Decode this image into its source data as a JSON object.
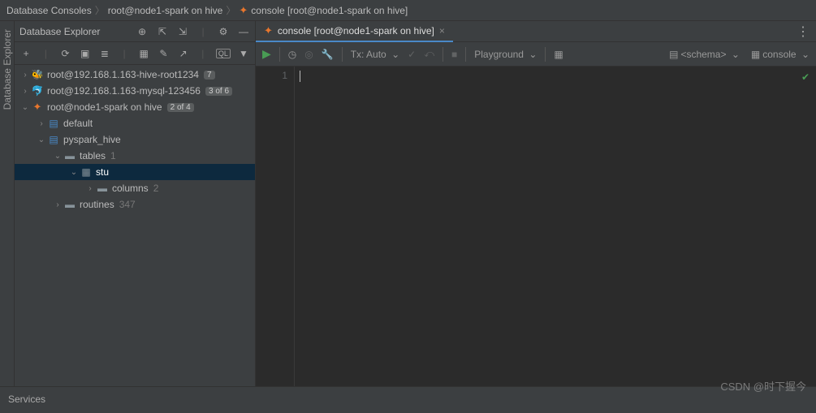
{
  "breadcrumb": {
    "root": "Database Consoles",
    "conn": "root@node1-spark on hive",
    "console": "console [root@node1-spark on hive]"
  },
  "sidebar": {
    "title": "Database Explorer",
    "vtab": "Database Explorer",
    "header_icons": [
      "target",
      "collapse",
      "expand",
      "divider",
      "gear",
      "minimize"
    ],
    "toolbar_icons": [
      "add",
      "divider",
      "refresh",
      "stop",
      "stack",
      "divider",
      "grid",
      "pencil",
      "jump",
      "divider",
      "ql",
      "filter"
    ]
  },
  "tree": {
    "n0": {
      "label": "root@192.168.1.163-hive-root1234",
      "badge": "7"
    },
    "n1": {
      "label": "root@192.168.1.163-mysql-123456",
      "badge": "3 of 6"
    },
    "n2": {
      "label": "root@node1-spark on hive",
      "badge": "2 of 4"
    },
    "n3": {
      "label": "default"
    },
    "n4": {
      "label": "pyspark_hive"
    },
    "n5": {
      "label": "tables",
      "badge": "1"
    },
    "n6": {
      "label": "stu"
    },
    "n7": {
      "label": "columns",
      "badge": "2"
    },
    "n8": {
      "label": "routines",
      "badge": "347"
    }
  },
  "tab": {
    "label": "console [root@node1-spark on hive]"
  },
  "editor_toolbar": {
    "tx": "Tx: Auto",
    "playground": "Playground",
    "schema": "<schema>",
    "console": "console"
  },
  "gutter": {
    "line1": "1"
  },
  "services": {
    "label": "Services"
  },
  "watermark": "CSDN @时下握今"
}
